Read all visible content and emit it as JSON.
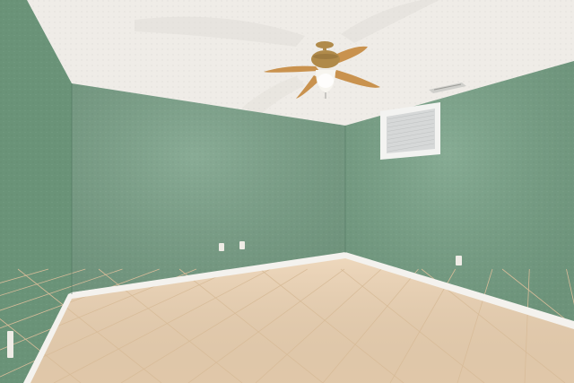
{
  "scene": {
    "description_alt": "",
    "colors": {
      "ceiling": "#efece7",
      "ceiling_shadow": "#d9d6d0",
      "wall_back": "#79a087",
      "wall_left": "#6a9378",
      "wall_right": "#76a085",
      "floor": "#ecd2b2",
      "floor_grout": "#d8bc99",
      "baseboard": "#f4f2ee",
      "fan_blade": "#c9924e",
      "fan_brass": "#b08a4a",
      "fan_light": "#f7f5ef",
      "window_frame": "#f3f3f1",
      "window_blind": "#d6d8d8",
      "vent": "#cfcfcb"
    }
  }
}
